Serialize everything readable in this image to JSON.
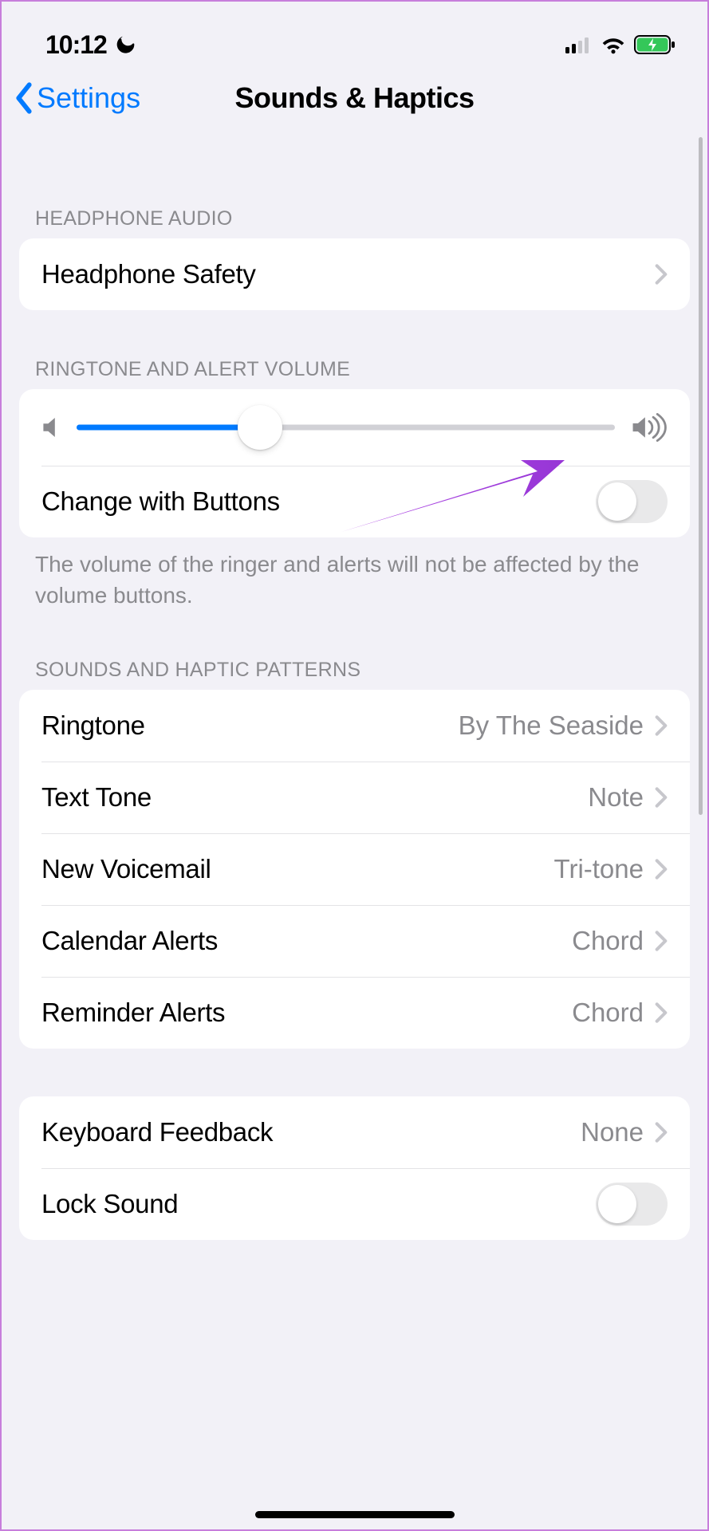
{
  "status_bar": {
    "time": "10:12"
  },
  "nav": {
    "back_label": "Settings",
    "title": "Sounds & Haptics"
  },
  "sections": {
    "headphone": {
      "header": "HEADPHONE AUDIO",
      "safety_label": "Headphone Safety"
    },
    "volume": {
      "header": "RINGTONE AND ALERT VOLUME",
      "slider_value_pct": 34,
      "change_with_buttons_label": "Change with Buttons",
      "change_with_buttons_on": false,
      "footer": "The volume of the ringer and alerts will not be affected by the volume buttons."
    },
    "patterns": {
      "header": "SOUNDS AND HAPTIC PATTERNS",
      "items": [
        {
          "label": "Ringtone",
          "value": "By The Seaside"
        },
        {
          "label": "Text Tone",
          "value": "Note"
        },
        {
          "label": "New Voicemail",
          "value": "Tri-tone"
        },
        {
          "label": "Calendar Alerts",
          "value": "Chord"
        },
        {
          "label": "Reminder Alerts",
          "value": "Chord"
        }
      ]
    },
    "other": {
      "keyboard_label": "Keyboard Feedback",
      "keyboard_value": "None",
      "lock_sound_label": "Lock Sound",
      "lock_sound_on": false
    }
  }
}
